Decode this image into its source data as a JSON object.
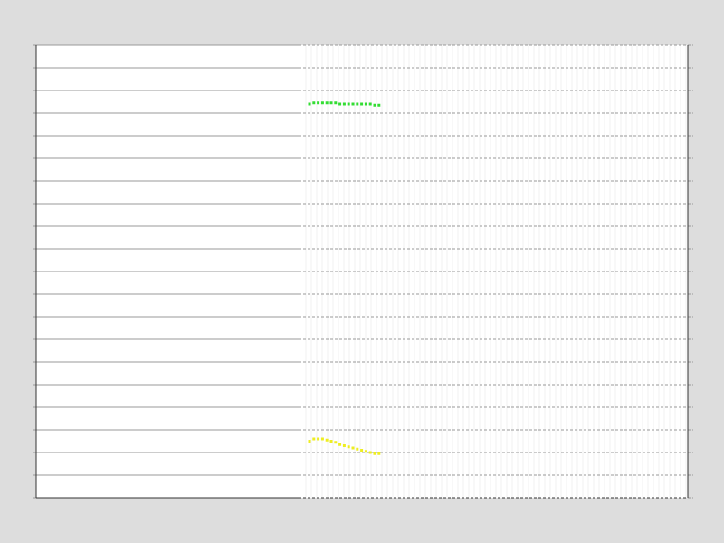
{
  "chart_data": {
    "type": "line",
    "title": "",
    "xlabel": "",
    "ylabel": "",
    "grid": true,
    "legend": "none",
    "ylim": [
      0,
      20
    ],
    "x": [
      0,
      1,
      2,
      3,
      4,
      5,
      6,
      7,
      8,
      9,
      10,
      11,
      12,
      13,
      14,
      15,
      16
    ],
    "series": [
      {
        "color": "#33dd33",
        "values": [
          17.4,
          17.45,
          17.45,
          17.45,
          17.45,
          17.45,
          17.45,
          17.4,
          17.4,
          17.4,
          17.4,
          17.4,
          17.4,
          17.4,
          17.4,
          17.35,
          17.35
        ]
      },
      {
        "color": "#eeee22",
        "values": [
          2.5,
          2.6,
          2.6,
          2.6,
          2.55,
          2.5,
          2.45,
          2.35,
          2.3,
          2.25,
          2.2,
          2.15,
          2.1,
          2.05,
          2.0,
          1.95,
          1.95
        ]
      }
    ]
  }
}
